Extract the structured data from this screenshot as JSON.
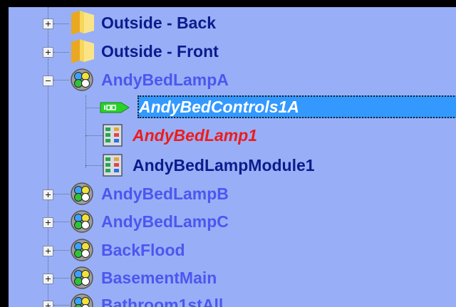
{
  "colors": {
    "background": "#98aff7",
    "folder_text": "#0d1b8c",
    "group_text": "#4c57ef",
    "selection": "#3399ff",
    "error_text": "#ee1c1c"
  },
  "tree": {
    "items": [
      {
        "label": "Outside - Back",
        "icon": "folder-icon",
        "state": "collapsed"
      },
      {
        "label": "Outside - Front",
        "icon": "folder-icon",
        "state": "collapsed"
      },
      {
        "label": "AndyBedLampA",
        "icon": "scene-icon",
        "state": "expanded"
      },
      {
        "label": "AndyBedControls1A",
        "icon": "controller-tag-icon",
        "state": "selected"
      },
      {
        "label": "AndyBedLamp1",
        "icon": "module-icon",
        "state": "error"
      },
      {
        "label": "AndyBedLampModule1",
        "icon": "module-icon",
        "state": "normal"
      },
      {
        "label": "AndyBedLampB",
        "icon": "scene-icon",
        "state": "collapsed"
      },
      {
        "label": "AndyBedLampC",
        "icon": "scene-icon",
        "state": "collapsed"
      },
      {
        "label": "BackFlood",
        "icon": "scene-icon",
        "state": "collapsed"
      },
      {
        "label": "BasementMain",
        "icon": "scene-icon",
        "state": "collapsed"
      },
      {
        "label": "Bathroom1stAll",
        "icon": "scene-icon",
        "state": "collapsed"
      }
    ]
  }
}
